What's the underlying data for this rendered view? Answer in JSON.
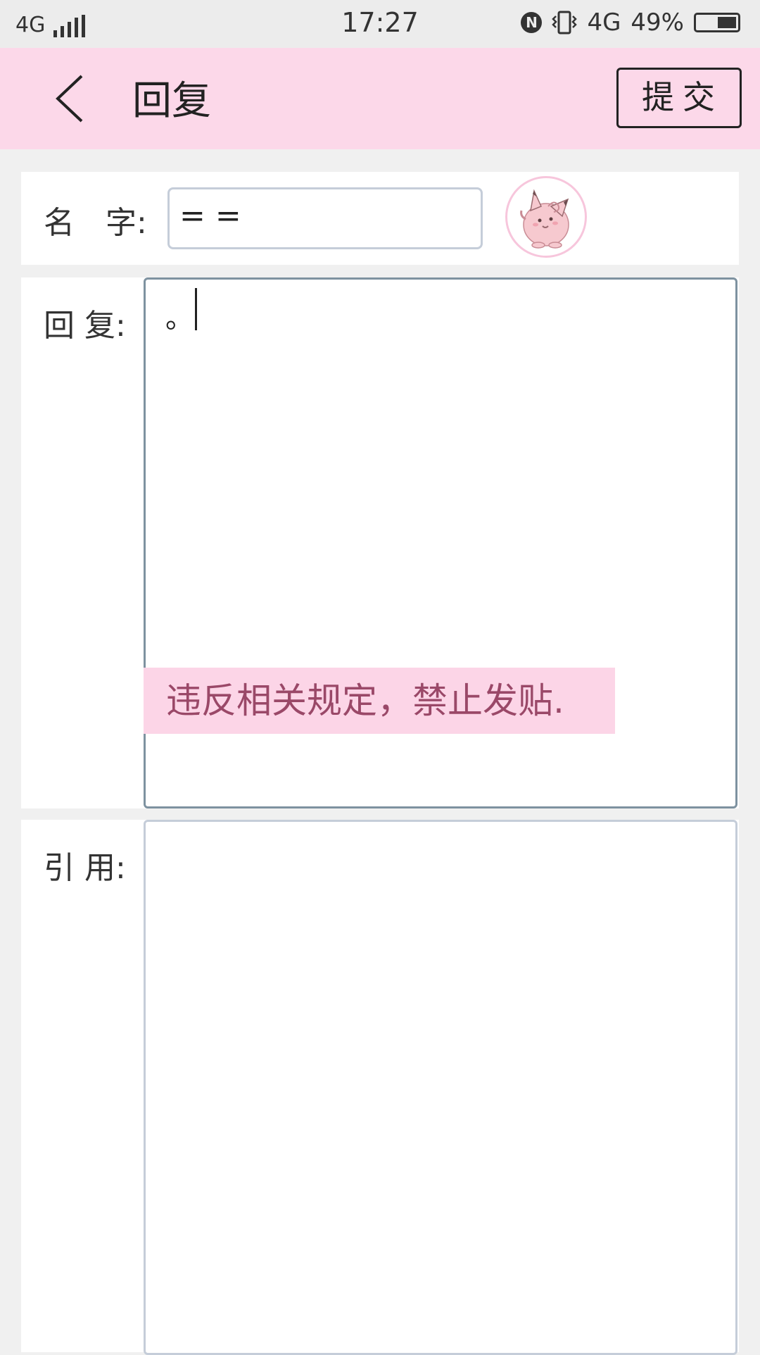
{
  "status_bar": {
    "network": "4G",
    "time": "17:27",
    "nfc": "N",
    "data": "4G",
    "battery": "49%",
    "icons": [
      "signal-icon",
      "nfc-icon",
      "vibrate-icon",
      "data-icon",
      "battery-icon"
    ]
  },
  "header": {
    "back_icon": "back-icon",
    "title": "回复",
    "submit_label": "提交",
    "bg_color": "#fcd8e9"
  },
  "form": {
    "name_label": "名　字:",
    "name_value": "= =",
    "avatar_icon": "avatar-image",
    "reply_label": "回 复:",
    "reply_value": "。",
    "quote_label": "引 用:",
    "quote_value": ""
  },
  "toast": {
    "message": "违反相关规定，禁止发贴.",
    "bg_color": "#fcd5e7",
    "text_color": "#9a4868"
  }
}
